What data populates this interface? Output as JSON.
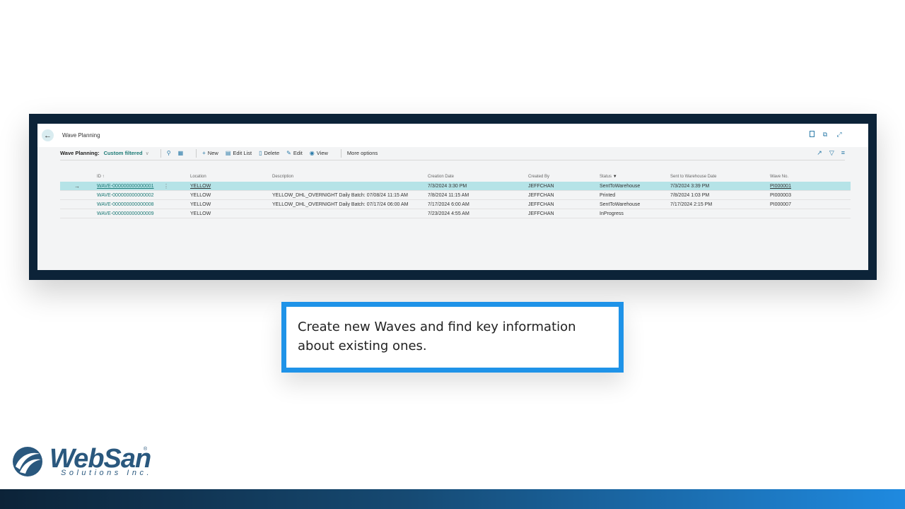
{
  "window": {
    "title": "Wave Planning"
  },
  "actionbar": {
    "title": "Wave Planning:",
    "filter": "Custom filtered",
    "new_label": "New",
    "edit_list_label": "Edit List",
    "delete_label": "Delete",
    "edit_label": "Edit",
    "view_label": "View",
    "more_label": "More options"
  },
  "table": {
    "headers": {
      "id": "ID ↑",
      "location": "Location",
      "description": "Description",
      "creation_date": "Creation Date",
      "created_by": "Created By",
      "status": "Status",
      "sent_date": "Sent to Warehouse Date",
      "wave_no": "Wave No."
    },
    "rows": [
      {
        "id": "WAVE-000000000000001",
        "location": "YELLOW",
        "description": "",
        "creation_date": "7/3/2024 3:30 PM",
        "created_by": "JEFFCHAN",
        "status": "SentToWarehouse",
        "sent_date": "7/3/2024 3:39 PM",
        "wave_no": "PI000001"
      },
      {
        "id": "WAVE-000000000000002",
        "location": "YELLOW",
        "description": "YELLOW_DHL_OVERNIGHT Daily Batch: 07/08/24 11:15 AM",
        "creation_date": "7/8/2024 11:15 AM",
        "created_by": "JEFFCHAN",
        "status": "Printed",
        "sent_date": "7/8/2024 1:03 PM",
        "wave_no": "PI000003"
      },
      {
        "id": "WAVE-000000000000008",
        "location": "YELLOW",
        "description": "YELLOW_DHL_OVERNIGHT Daily Batch: 07/17/24 06:00 AM",
        "creation_date": "7/17/2024 6:00 AM",
        "created_by": "JEFFCHAN",
        "status": "SentToWarehouse",
        "sent_date": "7/17/2024 2:15 PM",
        "wave_no": "PI000007"
      },
      {
        "id": "WAVE-000000000000009",
        "location": "YELLOW",
        "description": "",
        "creation_date": "7/23/2024 4:55 AM",
        "created_by": "JEFFCHAN",
        "status": "InProgress",
        "sent_date": "",
        "wave_no": ""
      }
    ]
  },
  "caption": {
    "text": "Create new Waves and find key information about existing ones."
  },
  "logo": {
    "name": "WebSan",
    "sub": "Solutions Inc."
  },
  "colors": {
    "frame": "#0c2338",
    "accent": "#1f93e8",
    "link": "#1d7a76",
    "selected_row": "#b5e3e7"
  }
}
